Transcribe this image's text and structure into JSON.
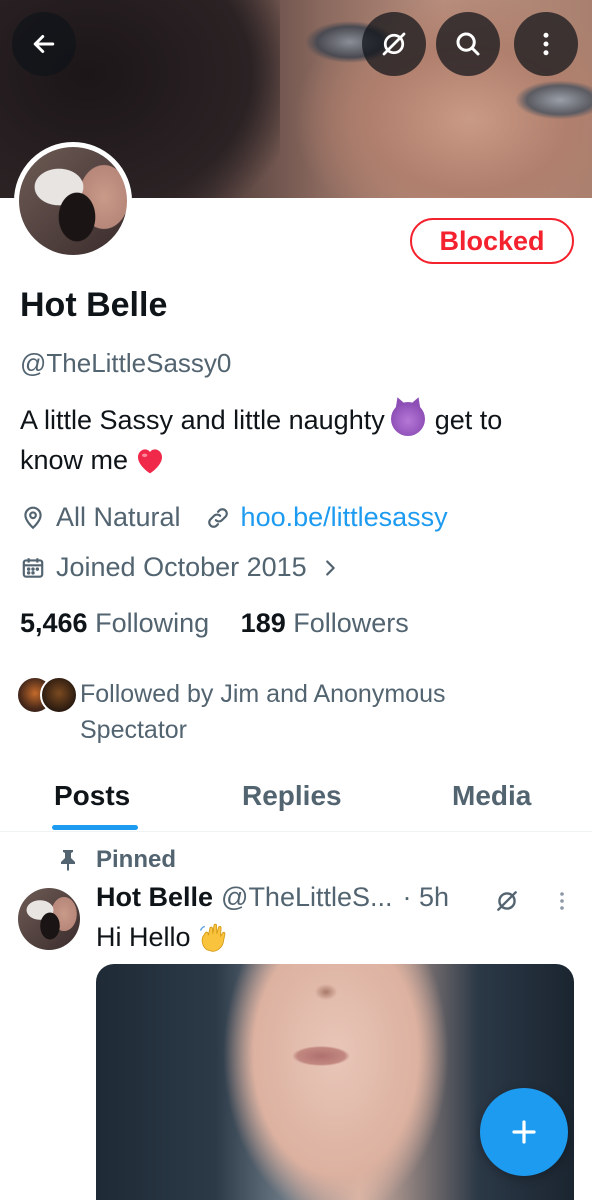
{
  "header": {
    "back_icon": "arrow-left-icon",
    "grok_icon": "grok-icon",
    "search_icon": "search-icon",
    "more_icon": "more-vertical-icon"
  },
  "profile": {
    "blocked_label": "Blocked",
    "display_name": "Hot Belle",
    "handle": "@TheLittleSassy0",
    "bio_part1": "A little Sassy and little naughty",
    "bio_part2": "get to know me",
    "location": "All Natural",
    "website": "hoo.be/littlesassy",
    "joined": "Joined October 2015",
    "following_count": "5,466",
    "following_label": "Following",
    "followers_count": "189",
    "followers_label": "Followers",
    "followed_by": "Followed by Jim and Anonymous Spectator"
  },
  "tabs": [
    {
      "label": "Posts",
      "active": true
    },
    {
      "label": "Replies",
      "active": false
    },
    {
      "label": "Media",
      "active": false
    }
  ],
  "post": {
    "pinned_label": "Pinned",
    "author_name": "Hot Belle",
    "author_handle": "@TheLittleS...",
    "time": "· 5h",
    "text": "Hi Hello"
  },
  "colors": {
    "accent": "#1d9bf0",
    "blocked": "#f4212e",
    "secondary_text": "#536471",
    "primary_text": "#0f1419"
  }
}
